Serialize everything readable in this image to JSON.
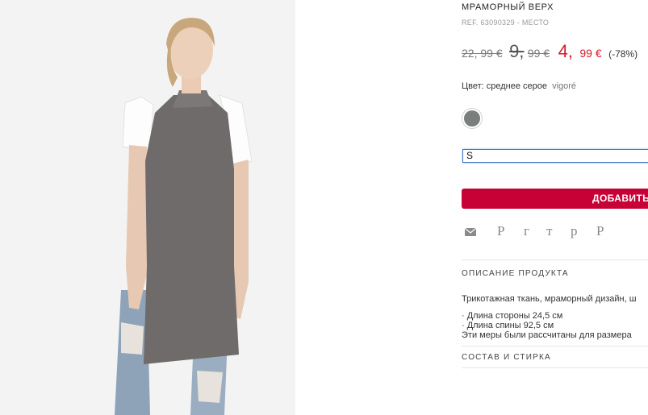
{
  "product": {
    "title": "МРАМОРНЫЙ ВЕРХ",
    "ref": "REF. 63090329 - МЕСТО",
    "image_alt": "Модель в сером трикотажном топе без рукавов"
  },
  "pricing": {
    "original": "22, 99 €",
    "previous_int": "9,",
    "previous_dec": "99 €",
    "current_int": "4,",
    "current_dec": "99 €",
    "discount": "(-78%)",
    "accent_color": "#d61b2b"
  },
  "color": {
    "label": "Цвет: среднее серое",
    "value": "vigoré",
    "swatch_hex": "#7a7e7c"
  },
  "size": {
    "selected": "S"
  },
  "cart": {
    "add_label": "ДОБАВИТЬ",
    "button_color": "#c70036"
  },
  "share": {
    "icons": [
      "mail-icon"
    ],
    "links": [
      "Р",
      "г",
      "т",
      "р",
      "Р"
    ]
  },
  "description": {
    "heading": "ОПИСАНИЕ ПРОДУКТА",
    "text": "Трикотажная ткань, мраморный дизайн, ш",
    "specs": [
      "· Длина стороны 24,5 см",
      "· Длина спины 92,5 см",
      "Эти меры были рассчитаны для размера"
    ]
  },
  "composition": {
    "heading": "СОСТАВ И СТИРКА"
  }
}
